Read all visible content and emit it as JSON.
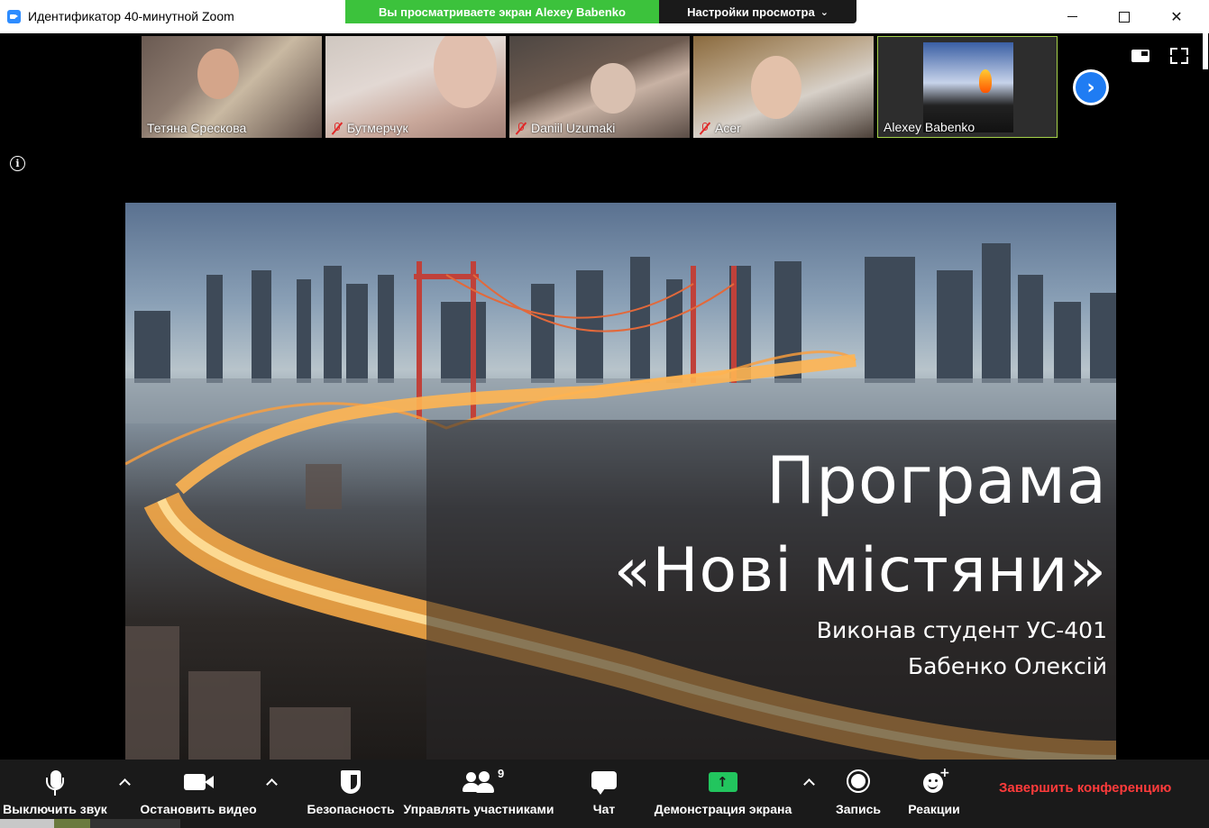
{
  "window": {
    "title": "Идентификатор 40-минутной Zoom",
    "controls": [
      "minimize",
      "maximize",
      "close"
    ]
  },
  "banner": {
    "viewing_text": "Вы просматриваете экран Alexey Babenko",
    "view_options_label": "Настройки просмотра",
    "view_options_icon": "chevron-down-icon"
  },
  "participants": [
    {
      "name": "Тетяна Єрескова",
      "muted": false
    },
    {
      "name": "Бутмерчук",
      "muted": true
    },
    {
      "name": "Daniil Uzumaki",
      "muted": true
    },
    {
      "name": "Acer",
      "muted": true
    },
    {
      "name": "Alexey Babenko",
      "muted": false,
      "active_speaker": true
    }
  ],
  "slide": {
    "title_line1": "Програма",
    "title_line2": "«Нові містяни»",
    "subtitle_line1": "Виконав студент УС-401",
    "subtitle_line2": "Бабенко Олексій"
  },
  "toolbar": {
    "mute_label": "Выключить звук",
    "video_label": "Остановить видео",
    "security_label": "Безопасность",
    "participants_label": "Управлять участниками",
    "participants_count": "9",
    "chat_label": "Чат",
    "share_label": "Демонстрация экрана",
    "record_label": "Запись",
    "reactions_label": "Реакции",
    "end_label": "Завершить конференцию"
  },
  "colors": {
    "banner_green": "#3cc23c",
    "active_speaker_border": "#a6d34a",
    "share_green": "#22c55e",
    "end_red": "#ff3b3b",
    "toolbar_bg": "#1a1a1a",
    "next_button_blue": "#1f7cf3"
  }
}
